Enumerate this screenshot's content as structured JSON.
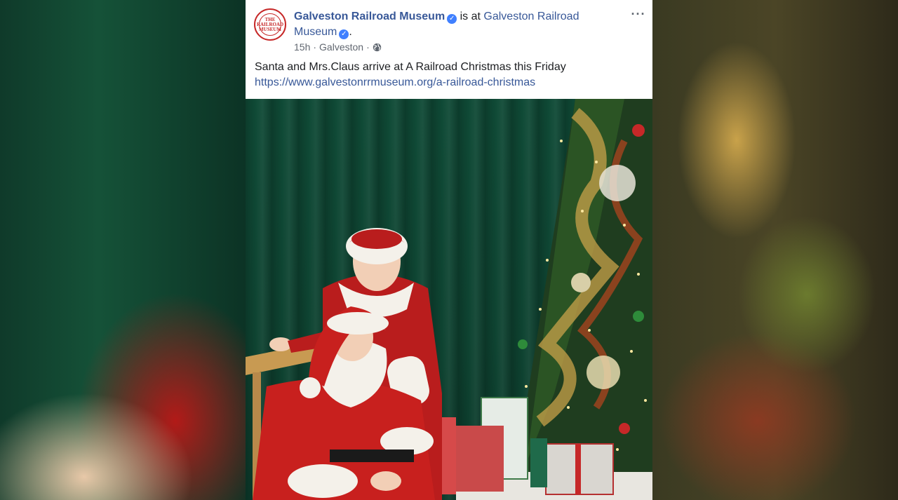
{
  "post": {
    "page_name": "Galveston Railroad Museum",
    "is_at": " is at ",
    "location_name": "Galveston Railroad Museum",
    "period": ".",
    "time": "15h",
    "place": "Galveston",
    "separator": "·",
    "text": "Santa and Mrs.Claus arrive at A Railroad Christmas this Friday",
    "link": "https://www.galvestonrrmuseum.org/a-railroad-christmas",
    "more_icon": "···"
  },
  "logo": {
    "text": "THE RAILROAD MUSEUM"
  },
  "colors": {
    "link": "#385898",
    "verified": "#4080ff",
    "logo_red": "#c62828"
  },
  "icons": [
    "verified-badge-icon",
    "globe-icon",
    "more-options-icon"
  ]
}
